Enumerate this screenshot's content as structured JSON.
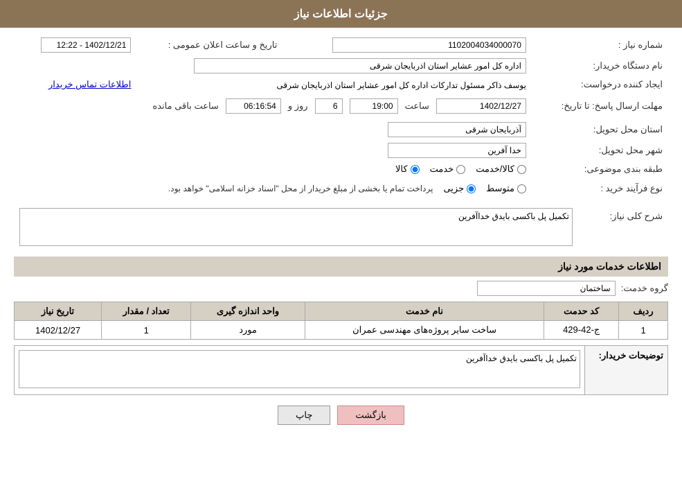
{
  "page": {
    "title": "جزئیات اطلاعات نیاز"
  },
  "fields": {
    "need_number_label": "شماره نیاز :",
    "need_number_value": "1102004034000070",
    "org_name_label": "نام دستگاه خریدار:",
    "org_name_value": "اداره کل امور عشایر استان اذربایجان شرقی",
    "announcement_label": "تاریخ و ساعت اعلان عمومی :",
    "announcement_value": "1402/12/21 - 12:22",
    "creator_label": "ایجاد کننده درخواست:",
    "creator_value": "یوسف ذاکر مسئول تدارکات اداره کل امور عشایر استان اذربایجان شرقی",
    "contact_link": "اطلاعات تماس خریدار",
    "reply_deadline_label": "مهلت ارسال پاسخ: تا تاریخ:",
    "reply_date_value": "1402/12/27",
    "reply_time_value": "19:00",
    "reply_days_label": "روز و",
    "reply_days_value": "6",
    "reply_remaining_label": "ساعت باقی مانده",
    "reply_remaining_value": "06:16:54",
    "province_label": "استان محل تحویل:",
    "province_value": "آذربایجان شرقی",
    "city_label": "شهر محل تحویل:",
    "city_value": "خدا آفرین",
    "category_label": "طبقه بندی موضوعی:",
    "category_options": [
      "کالا",
      "خدمت",
      "کالا/خدمت"
    ],
    "category_selected": "کالا",
    "process_label": "نوع فرآیند خرید :",
    "process_options": [
      "جزیی",
      "متوسط"
    ],
    "process_note": "پرداخت تمام یا بخشی از مبلغ خریدار از محل \"اسناد خزانه اسلامی\" خواهد بود.",
    "need_desc_label": "شرح کلی نیاز:",
    "need_desc_value": "تکمیل پل باکسی بایدق خداآفرین",
    "services_section_label": "اطلاعات خدمات مورد نیاز",
    "service_group_label": "گروه خدمت:",
    "service_group_value": "ساختمان",
    "table_headers": [
      "ردیف",
      "کد حدمت",
      "نام خدمت",
      "واحد اندازه گیری",
      "تعداد / مقدار",
      "تاریخ نیاز"
    ],
    "table_rows": [
      {
        "row": "1",
        "code": "ج-42-429",
        "name": "ساخت سایر پروژه‌های مهندسی عمران",
        "unit": "مورد",
        "quantity": "1",
        "date": "1402/12/27"
      }
    ],
    "buyer_desc_label": "توضیحات خریدار:",
    "buyer_desc_value": "تکمیل پل باکسی بایدق خداآفرین",
    "btn_print": "چاپ",
    "btn_back": "بازگشت"
  }
}
